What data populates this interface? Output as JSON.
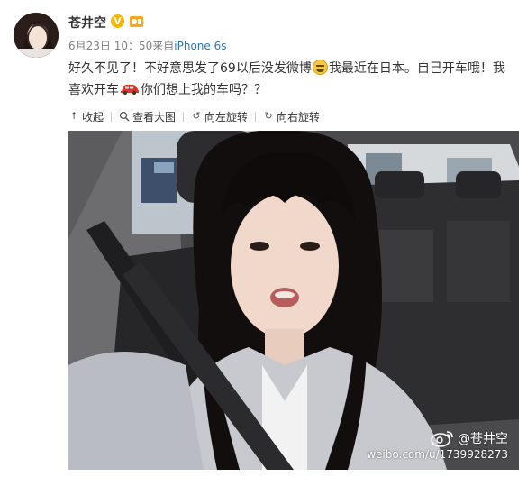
{
  "post": {
    "username": "苍井空",
    "verified_badge": "V",
    "date": "6月23日 10：50",
    "source_prefix": "来自",
    "device": "iPhone 6s",
    "text_part1": "好久不见了！不好意思发了69以后没发微博",
    "text_part2": "我最近在日本。自己开车哦！我喜欢开车",
    "text_part3": "你们想上我的车吗？？"
  },
  "toolbar": {
    "collapse_label": "收起",
    "view_large_label": "查看大图",
    "rotate_left_label": "向左旋转",
    "rotate_right_label": "向右旋转"
  },
  "watermark": {
    "handle": "@苍井空",
    "url": "weibo.com/u/1739928273"
  },
  "icons": {
    "collapse": "arrow-up-icon",
    "view_large": "magnifier-icon",
    "rotate_left": "rotate-left-icon",
    "rotate_right": "rotate-right-icon",
    "emoji1": "laughing-emoji-icon",
    "emoji2": "red-car-emoji-icon"
  },
  "colors": {
    "link_blue": "#2e78b4",
    "meta_gray": "#808080",
    "badge_gold": "#f7b500"
  }
}
